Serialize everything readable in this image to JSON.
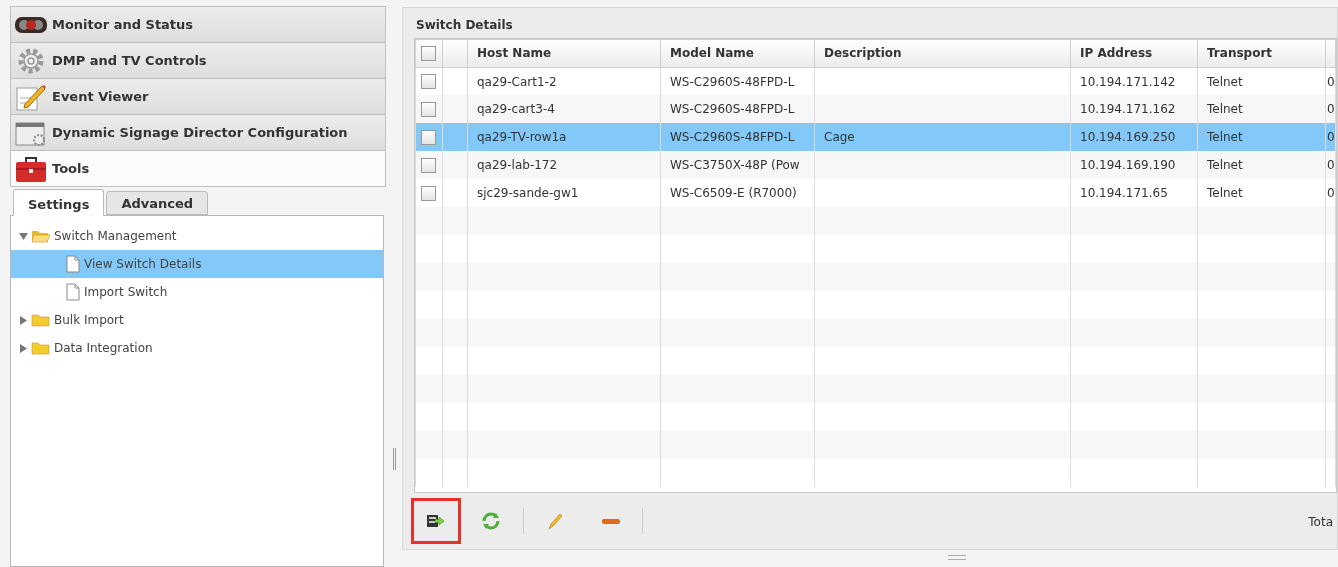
{
  "accordion": [
    {
      "kind": "monitor",
      "label": "Monitor and Status",
      "selected": false
    },
    {
      "kind": "gear",
      "label": "DMP and TV Controls",
      "selected": false
    },
    {
      "kind": "pencil",
      "label": "Event Viewer",
      "selected": false
    },
    {
      "kind": "window",
      "label": "Dynamic Signage Director Configuration",
      "selected": false
    },
    {
      "kind": "toolbox",
      "label": "Tools",
      "selected": true
    }
  ],
  "tabs": [
    {
      "label": "Settings",
      "selected": true
    },
    {
      "label": "Advanced",
      "selected": false
    }
  ],
  "tree": [
    {
      "kind": "folder",
      "label": "Switch Management",
      "expanded": true,
      "selected": false,
      "children": [
        {
          "kind": "page",
          "label": "View Switch Details",
          "selected": true
        },
        {
          "kind": "page",
          "label": "Import Switch",
          "selected": false
        }
      ]
    },
    {
      "kind": "folder",
      "label": "Bulk Import",
      "expanded": false,
      "selected": false
    },
    {
      "kind": "folder",
      "label": "Data Integration",
      "expanded": false,
      "selected": false
    }
  ],
  "panel": {
    "title": "Switch Details"
  },
  "table": {
    "header_checked": false,
    "columns": [
      "Host Name",
      "Model Name",
      "Description",
      "IP Address",
      "Transport"
    ],
    "rows": [
      {
        "checked": false,
        "selected": false,
        "cells": [
          "qa29-Cart1-2",
          "WS-C2960S-48FPD-L",
          "",
          "10.194.171.142",
          "Telnet",
          "0"
        ]
      },
      {
        "checked": false,
        "selected": false,
        "cells": [
          "qa29-cart3-4",
          "WS-C2960S-48FPD-L",
          "",
          "10.194.171.162",
          "Telnet",
          "0"
        ]
      },
      {
        "checked": false,
        "selected": true,
        "cells": [
          "qa29-TV-row1a",
          "WS-C2960S-48FPD-L",
          "Cage",
          "10.194.169.250",
          "Telnet",
          "0"
        ]
      },
      {
        "checked": false,
        "selected": false,
        "cells": [
          "qa29-lab-172",
          "WS-C3750X-48P (Pow",
          "",
          "10.194.169.190",
          "Telnet",
          "0"
        ]
      },
      {
        "checked": false,
        "selected": false,
        "cells": [
          "sjc29-sande-gw1",
          "WS-C6509-E (R7000)",
          "",
          "10.194.171.65",
          "Telnet",
          "0"
        ]
      }
    ]
  },
  "toolbar": [
    {
      "kind": "import",
      "highlighted": true
    },
    {
      "kind": "refresh",
      "highlighted": false
    },
    {
      "kind": "edit",
      "highlighted": false
    },
    {
      "kind": "remove",
      "highlighted": false
    }
  ],
  "status": "Tota"
}
